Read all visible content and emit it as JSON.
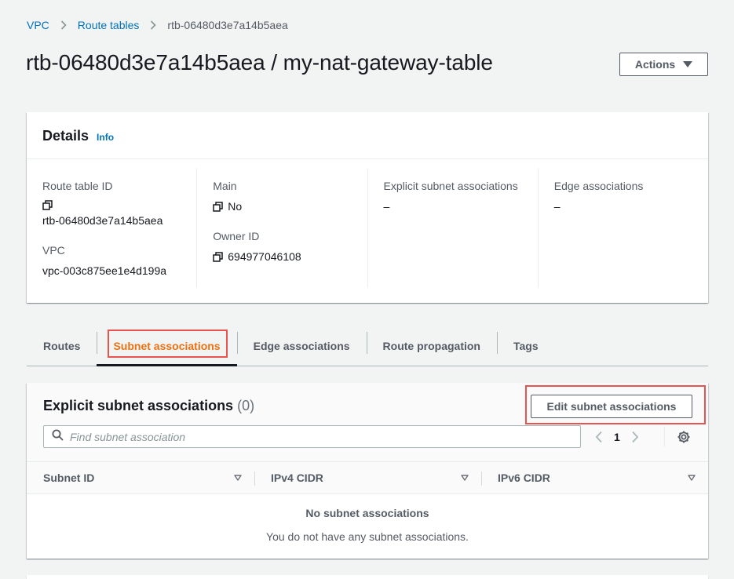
{
  "breadcrumb": {
    "items": [
      "VPC",
      "Route tables"
    ],
    "current": "rtb-06480d3e7a14b5aea"
  },
  "page": {
    "title": "rtb-06480d3e7a14b5aea / my-nat-gateway-table",
    "actions_label": "Actions"
  },
  "details": {
    "title": "Details",
    "info_label": "Info",
    "route_table_id_label": "Route table ID",
    "route_table_id": "rtb-06480d3e7a14b5aea",
    "vpc_label": "VPC",
    "vpc": "vpc-003c875ee1e4d199a",
    "main_label": "Main",
    "main": "No",
    "owner_id_label": "Owner ID",
    "owner_id": "694977046108",
    "explicit_label": "Explicit subnet associations",
    "explicit": "–",
    "edge_label": "Edge associations",
    "edge": "–"
  },
  "tabs": [
    {
      "label": "Routes",
      "active": false
    },
    {
      "label": "Subnet associations",
      "active": true
    },
    {
      "label": "Edge associations",
      "active": false
    },
    {
      "label": "Route propagation",
      "active": false
    },
    {
      "label": "Tags",
      "active": false
    }
  ],
  "associations": {
    "title": "Explicit subnet associations",
    "count": "(0)",
    "edit_label": "Edit subnet associations",
    "search_placeholder": "Find subnet association",
    "page": "1",
    "columns": [
      "Subnet ID",
      "IPv4 CIDR",
      "IPv6 CIDR"
    ],
    "empty_title": "No subnet associations",
    "empty_message": "You do not have any subnet associations."
  },
  "colors": {
    "link": "#0073bb",
    "active_tab": "#ec7211",
    "highlight": "#e8534f",
    "background": "#f2f3f3"
  }
}
